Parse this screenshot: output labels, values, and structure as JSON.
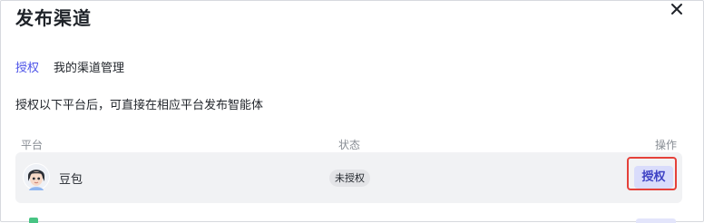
{
  "dialog": {
    "title": "发布渠道"
  },
  "tabs": [
    {
      "label": "授权",
      "active": true
    },
    {
      "label": "我的渠道管理",
      "active": false
    }
  ],
  "description": "授权以下平台后，可直接在相应平台发布智能体",
  "table": {
    "headers": [
      "平台",
      "状态",
      "操作"
    ],
    "rows": [
      {
        "platform": "豆包",
        "status": "未授权",
        "action": "授权"
      }
    ]
  },
  "colors": {
    "accent": "#4d53e8",
    "highlight_outline": "#e5413a",
    "row_background": "#f1f2f4",
    "button_background": "#d9dcfb"
  },
  "icons": {
    "close": "close-icon",
    "platform_avatar": "doubao-avatar-icon"
  }
}
